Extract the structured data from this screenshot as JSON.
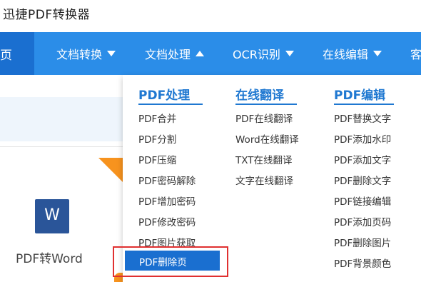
{
  "app": {
    "title": "迅捷PDF转换器"
  },
  "nav": {
    "home": "页",
    "items": [
      "文档转换",
      "文档处理",
      "OCR识别",
      "在线编辑",
      "客"
    ]
  },
  "card": {
    "label": "PDF转Word",
    "icon_letter": "W"
  },
  "dropdown": {
    "columns": [
      {
        "title": "PDF处理",
        "items": [
          "PDF合并",
          "PDF分割",
          "PDF压缩",
          "PDF密码解除",
          "PDF增加密码",
          "PDF修改密码",
          "PDF图片获取",
          "PDF删除页"
        ]
      },
      {
        "title": "在线翻译",
        "items": [
          "PDF在线翻译",
          "Word在线翻译",
          "TXT在线翻译",
          "文字在线翻译"
        ]
      },
      {
        "title": "PDF编辑",
        "items": [
          "PDF替换文字",
          "PDF添加水印",
          "PDF添加文字",
          "PDF删除文字",
          "PDF链接编辑",
          "PDF添加页码",
          "PDF删除图片",
          "PDF背景颜色"
        ]
      }
    ],
    "highlighted": "PDF删除页"
  },
  "colors": {
    "nav_blue": "#2b8de8",
    "active_blue": "#1a6fd0",
    "accent_red": "#e03030",
    "brand_orange": "#f7931e"
  },
  "icons": {
    "dropdown_caret": "caret-down-icon",
    "active_caret": "caret-up-icon",
    "word_app": "word-icon"
  }
}
